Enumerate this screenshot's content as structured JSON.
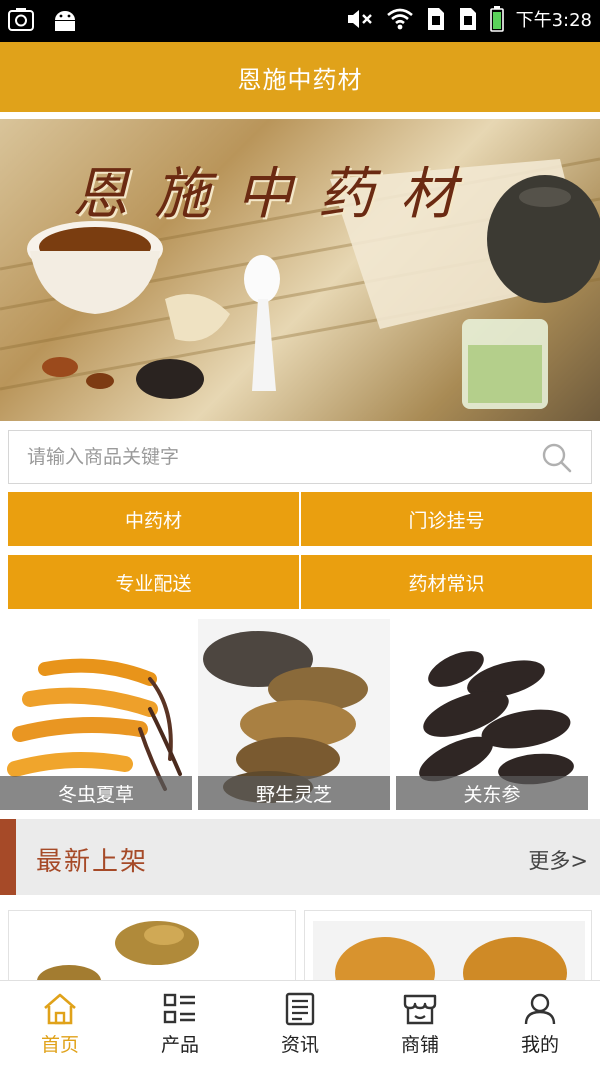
{
  "status_bar": {
    "time": "下午3:28",
    "icons": [
      "screenshot-icon",
      "android-icon",
      "mute-icon",
      "wifi-icon",
      "sim-icon",
      "sim-icon",
      "battery-icon"
    ]
  },
  "header": {
    "title": "恩施中药材"
  },
  "banner": {
    "title": "恩施中药材"
  },
  "search": {
    "placeholder": "请输入商品关键字",
    "value": ""
  },
  "categories": [
    {
      "label": "中药材"
    },
    {
      "label": "门诊挂号"
    },
    {
      "label": "专业配送"
    },
    {
      "label": "药材常识"
    }
  ],
  "featured": [
    {
      "label": "冬虫夏草"
    },
    {
      "label": "野生灵芝"
    },
    {
      "label": "关东参"
    }
  ],
  "section": {
    "title": "最新上架",
    "more": "更多>"
  },
  "bottom_nav": [
    {
      "label": "首页",
      "icon": "home-icon",
      "active": true
    },
    {
      "label": "产品",
      "icon": "product-list-icon",
      "active": false
    },
    {
      "label": "资讯",
      "icon": "news-icon",
      "active": false
    },
    {
      "label": "商铺",
      "icon": "shop-icon",
      "active": false
    },
    {
      "label": "我的",
      "icon": "user-icon",
      "active": false
    }
  ],
  "colors": {
    "accent": "#e0a21a",
    "button": "#ea9f0f",
    "section_accent": "#a64a28"
  }
}
